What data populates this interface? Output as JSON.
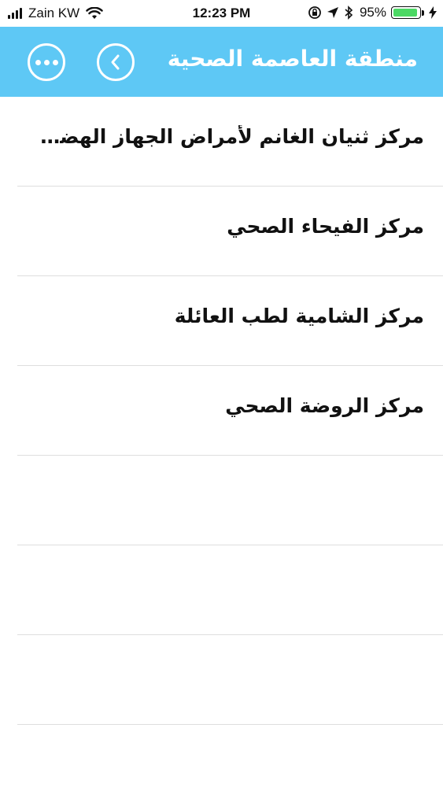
{
  "status_bar": {
    "carrier": "Zain KW",
    "time": "12:23 PM",
    "battery_percent": "95%",
    "battery_level": 0.95,
    "battery_color": "#4cd964"
  },
  "header": {
    "title": "منطقة العاصمة الصحية",
    "background_color": "#5ec8f5",
    "more_icon": "more-dots-icon",
    "back_icon": "chevron-left-icon"
  },
  "list": {
    "items": [
      {
        "label": "مركز ثنيان الغانم لأمراض الجهاز الهضمي"
      },
      {
        "label": "مركز الفيحاء الصحي"
      },
      {
        "label": "مركز الشامية لطب العائلة"
      },
      {
        "label": "مركز الروضة الصحي"
      },
      {
        "label": ""
      },
      {
        "label": ""
      },
      {
        "label": ""
      }
    ]
  }
}
